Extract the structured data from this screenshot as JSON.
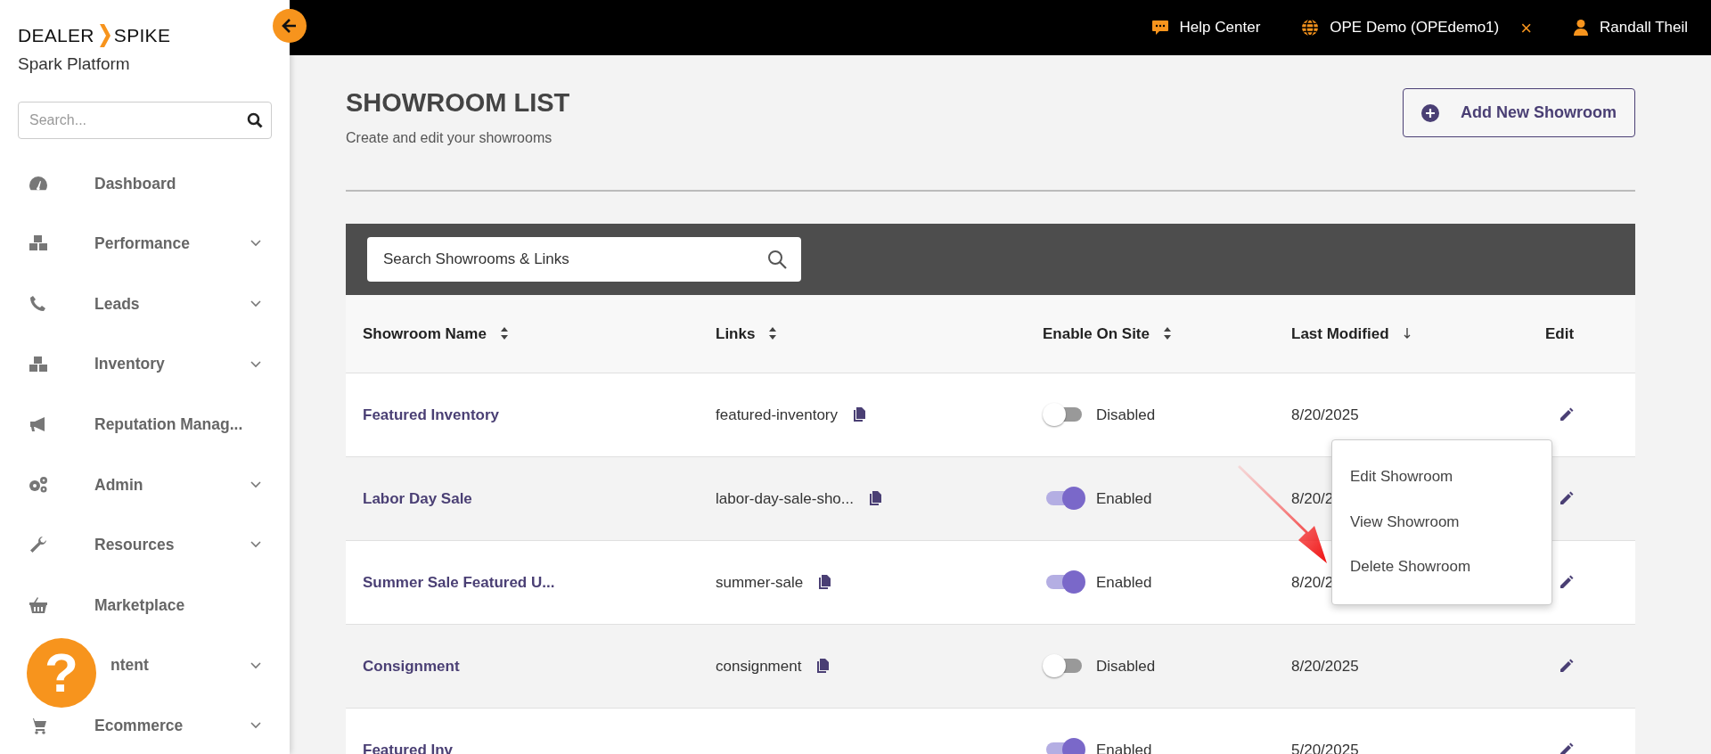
{
  "brand": {
    "logo_left": "DEALER",
    "logo_right": "SPIKE",
    "subtitle": "Spark Platform"
  },
  "sidebar": {
    "search": {
      "placeholder": "Search..."
    },
    "items": [
      {
        "label": "Dashboard",
        "expandable": false
      },
      {
        "label": "Performance",
        "expandable": true
      },
      {
        "label": "Leads",
        "expandable": true
      },
      {
        "label": "Inventory",
        "expandable": true
      },
      {
        "label": "Reputation Manag...",
        "expandable": false
      },
      {
        "label": "Admin",
        "expandable": true
      },
      {
        "label": "Resources",
        "expandable": true
      },
      {
        "label": "Marketplace",
        "expandable": false
      },
      {
        "label": "ntent",
        "expandable": true
      },
      {
        "label": "Ecommerce",
        "expandable": true
      }
    ]
  },
  "topbar": {
    "help": "Help Center",
    "dealer": "OPE Demo (OPEdemo1)",
    "close": "×",
    "user": "Randall Theil"
  },
  "page": {
    "title": "SHOWROOM LIST",
    "subtitle": "Create and edit your showrooms",
    "add_button": "Add New Showroom"
  },
  "table": {
    "search": {
      "placeholder": "Search Showrooms & Links"
    },
    "columns": [
      {
        "label": "Showroom Name",
        "sortable": true,
        "sorted": false
      },
      {
        "label": "Links",
        "sortable": true,
        "sorted": false
      },
      {
        "label": "Enable On Site",
        "sortable": true,
        "sorted": false
      },
      {
        "label": "Last Modified",
        "sortable": true,
        "sorted": true
      },
      {
        "label": "Edit",
        "sortable": false
      }
    ],
    "rows": [
      {
        "name": "Featured Inventory",
        "link": "featured-inventory",
        "status": "Disabled",
        "on": false,
        "modified": "8/20/2025"
      },
      {
        "name": "Labor Day Sale",
        "link": "labor-day-sale-sho...",
        "status": "Enabled",
        "on": true,
        "modified": "8/20/2"
      },
      {
        "name": "Summer Sale Featured U...",
        "link": "summer-sale",
        "status": "Enabled",
        "on": true,
        "modified": "8/20/2"
      },
      {
        "name": "Consignment",
        "link": "consignment",
        "status": "Disabled",
        "on": false,
        "modified": "8/20/2025"
      },
      {
        "name": "Featured Inv",
        "link": "",
        "status": "Enabled",
        "on": true,
        "modified": "5/20/2025"
      }
    ]
  },
  "context_menu": {
    "items": [
      "Edit Showroom",
      "View Showroom",
      "Delete Showroom"
    ]
  },
  "help_button": "?"
}
